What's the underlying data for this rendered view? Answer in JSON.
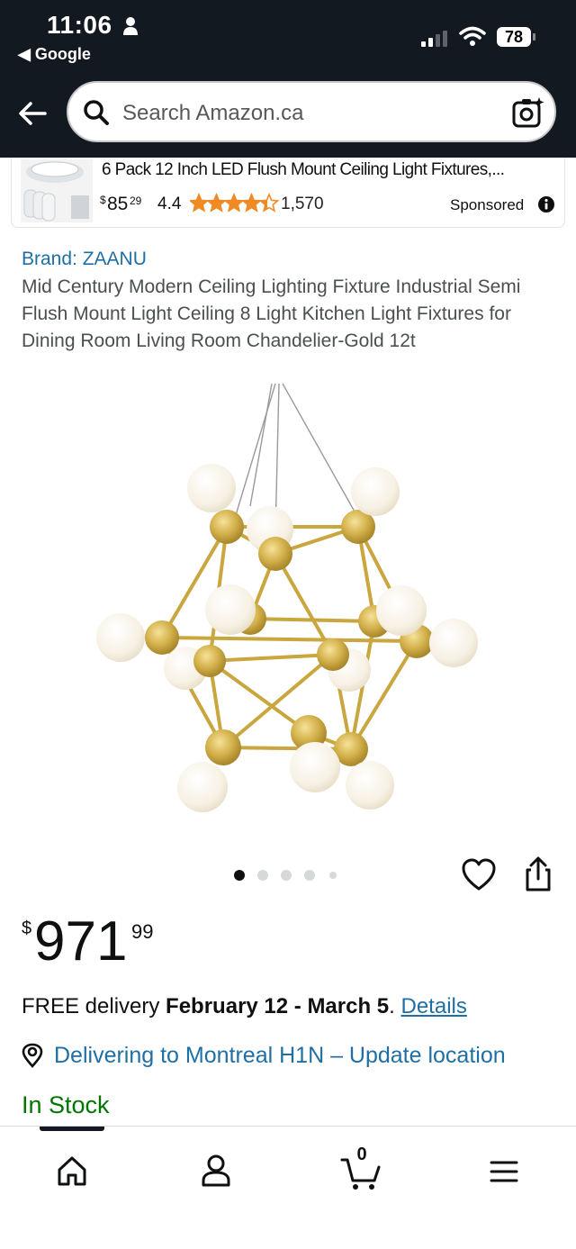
{
  "status_bar": {
    "time": "11:06",
    "back_app": "◀ Google",
    "battery": "78"
  },
  "search": {
    "placeholder": "Search Amazon.ca"
  },
  "sponsored": {
    "title": "6 Pack 12 Inch LED Flush Mount Ceiling Light Fixtures,...",
    "price_symbol": "$",
    "price_whole": "85",
    "price_fraction": "29",
    "rating": "4.4",
    "rating_value": 4.4,
    "review_count": "1,570",
    "label": "Sponsored"
  },
  "product": {
    "brand": "Brand: ZAANU",
    "title": "Mid Century Modern Ceiling Lighting Fixture Industrial Semi Flush Mount Light Ceiling 8 Light Kitchen Light Fixtures for Dining Room Living Room Chandelier-Gold 12t",
    "image_count": 5,
    "active_image": 1,
    "price_symbol": "$",
    "price_whole": "971",
    "price_fraction": "99"
  },
  "delivery": {
    "prefix": "FREE delivery ",
    "dates": "February 12 - March 5",
    "suffix": ". ",
    "details_link": "Details",
    "location": "Delivering to Montreal H1N – Update location"
  },
  "stock": "In Stock",
  "bottom_nav": {
    "cart_count": "0",
    "items": [
      "home-icon",
      "account-icon",
      "cart-icon",
      "menu-icon"
    ]
  },
  "colors": {
    "header_bg": "#131921",
    "link": "#1f6fa5",
    "in_stock": "#007600",
    "star": "#f08a24"
  }
}
